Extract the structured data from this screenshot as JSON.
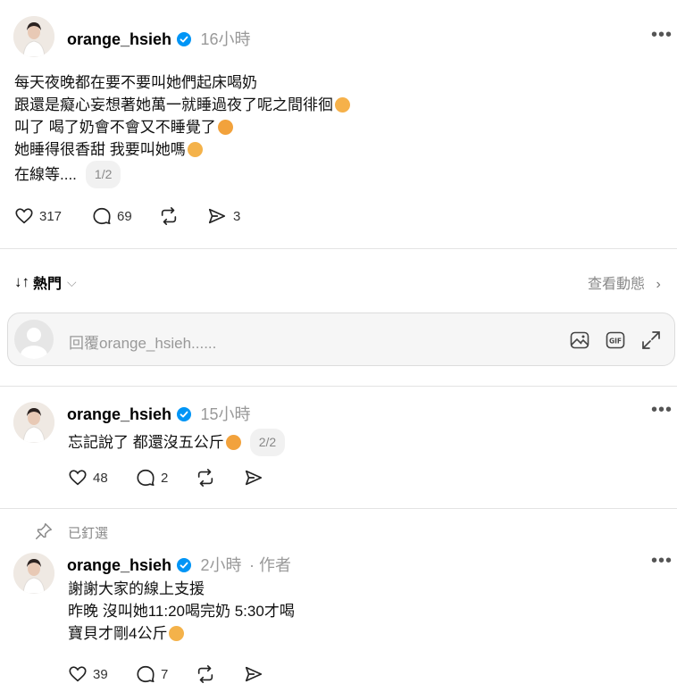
{
  "post": {
    "username": "orange_hsieh",
    "time": "16小時",
    "lines": [
      "每天夜晚都在要不要叫她們起床喝奶",
      "跟還是癡心妄想著她萬一就睡過夜了呢之間徘徊",
      "叫了 喝了奶會不會又不睡覺了",
      "她睡得很香甜 我要叫她嗎",
      "在線等...."
    ],
    "pager": "1/2",
    "likes": "317",
    "comments": "69",
    "shares": "3"
  },
  "sort": {
    "label": "熱門",
    "view_activity": "查看動態"
  },
  "reply": {
    "placeholder": "回覆orange_hsieh......"
  },
  "comments": [
    {
      "username": "orange_hsieh",
      "time": "15小時",
      "lines": [
        "忘記說了 都還沒五公斤"
      ],
      "pager": "2/2",
      "likes": "48",
      "comments": "2"
    },
    {
      "pinned_label": "已釘選",
      "username": "orange_hsieh",
      "time": "2小時",
      "author_tag": "· 作者",
      "lines": [
        "謝謝大家的線上支援",
        "昨晚 沒叫她11:20喝完奶 5:30才喝",
        "寶貝才剛4公斤"
      ],
      "likes": "39",
      "comments": "7"
    }
  ],
  "colors": {
    "verified": "#0095f6",
    "divider": "#e3e3e3"
  }
}
